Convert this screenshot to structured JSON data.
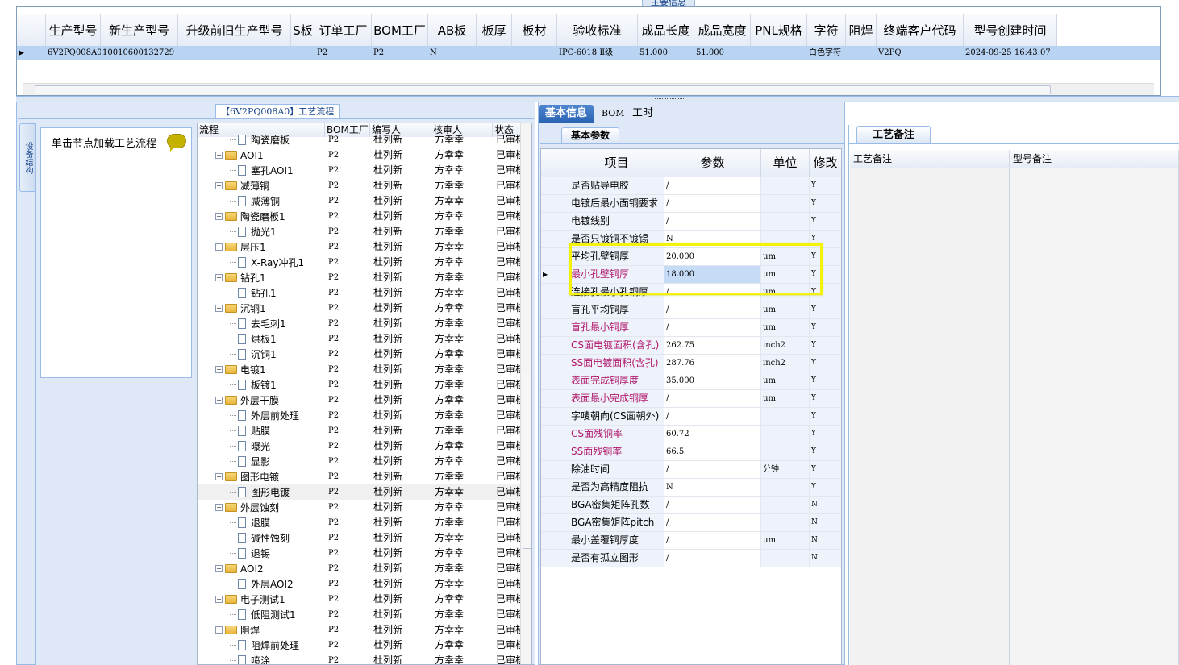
{
  "section_title": "主要信息",
  "main_grid": {
    "columns": [
      "生产型号",
      "新生产型号",
      "升级前旧生产型号",
      "S板",
      "订单工厂",
      "BOM工厂",
      "AB板",
      "板厚",
      "板材",
      "验收标准",
      "成品长度",
      "成品宽度",
      "PNL规格",
      "字符",
      "阻焊",
      "终端客户代码",
      "型号创建时间"
    ],
    "row": [
      "6V2PQ008A0",
      "10010600132729",
      "",
      "",
      "P2",
      "P2",
      "N",
      "",
      "",
      "IPC-6018 Ⅱ级",
      "51.000",
      "51.000",
      "",
      "白色字符",
      "",
      "V2PQ",
      "2024-09-25 16:43:07"
    ]
  },
  "flow_panel": {
    "title": "【6V2PQ008A0】工艺流程",
    "vertical_tab": "设备结构",
    "hint": "单击节点加载工艺流程"
  },
  "tree": {
    "columns": [
      "流程",
      "BOM工厂",
      "编写人",
      "核审人",
      "状态"
    ],
    "rows": [
      {
        "level": 1,
        "type": "doc",
        "name": "陶瓷磨板",
        "bom": "P2",
        "writer": "杜列新",
        "reviewer": "方幸幸",
        "status": "已审核"
      },
      {
        "level": 0,
        "type": "folder",
        "name": "AOI1",
        "bom": "P2",
        "writer": "杜列新",
        "reviewer": "方幸幸",
        "status": "已审核"
      },
      {
        "level": 1,
        "type": "doc",
        "name": "塞孔AOI1",
        "bom": "P2",
        "writer": "杜列新",
        "reviewer": "方幸幸",
        "status": "已审核"
      },
      {
        "level": 0,
        "type": "folder",
        "name": "减薄铜",
        "bom": "P2",
        "writer": "杜列新",
        "reviewer": "方幸幸",
        "status": "已审核"
      },
      {
        "level": 1,
        "type": "doc",
        "name": "减薄铜",
        "bom": "P2",
        "writer": "杜列新",
        "reviewer": "方幸幸",
        "status": "已审核"
      },
      {
        "level": 0,
        "type": "folder",
        "name": "陶瓷磨板1",
        "bom": "P2",
        "writer": "杜列新",
        "reviewer": "方幸幸",
        "status": "已审核"
      },
      {
        "level": 1,
        "type": "doc",
        "name": "抛光1",
        "bom": "P2",
        "writer": "杜列新",
        "reviewer": "方幸幸",
        "status": "已审核"
      },
      {
        "level": 0,
        "type": "folder",
        "name": "层压1",
        "bom": "P2",
        "writer": "杜列新",
        "reviewer": "方幸幸",
        "status": "已审核"
      },
      {
        "level": 1,
        "type": "doc",
        "name": "X-Ray冲孔1",
        "bom": "P2",
        "writer": "杜列新",
        "reviewer": "方幸幸",
        "status": "已审核"
      },
      {
        "level": 0,
        "type": "folder",
        "name": "钻孔1",
        "bom": "P2",
        "writer": "杜列新",
        "reviewer": "方幸幸",
        "status": "已审核"
      },
      {
        "level": 1,
        "type": "doc",
        "name": "钻孔1",
        "bom": "P2",
        "writer": "杜列新",
        "reviewer": "方幸幸",
        "status": "已审核"
      },
      {
        "level": 0,
        "type": "folder",
        "name": "沉铜1",
        "bom": "P2",
        "writer": "杜列新",
        "reviewer": "方幸幸",
        "status": "已审核"
      },
      {
        "level": 1,
        "type": "doc",
        "name": "去毛刺1",
        "bom": "P2",
        "writer": "杜列新",
        "reviewer": "方幸幸",
        "status": "已审核"
      },
      {
        "level": 1,
        "type": "doc",
        "name": "烘板1",
        "bom": "P2",
        "writer": "杜列新",
        "reviewer": "方幸幸",
        "status": "已审核"
      },
      {
        "level": 1,
        "type": "doc",
        "name": "沉铜1",
        "bom": "P2",
        "writer": "杜列新",
        "reviewer": "方幸幸",
        "status": "已审核"
      },
      {
        "level": 0,
        "type": "folder",
        "name": "电镀1",
        "bom": "P2",
        "writer": "杜列新",
        "reviewer": "方幸幸",
        "status": "已审核"
      },
      {
        "level": 1,
        "type": "doc",
        "name": "板镀1",
        "bom": "P2",
        "writer": "杜列新",
        "reviewer": "方幸幸",
        "status": "已审核"
      },
      {
        "level": 0,
        "type": "folder",
        "name": "外层干膜",
        "bom": "P2",
        "writer": "杜列新",
        "reviewer": "方幸幸",
        "status": "已审核"
      },
      {
        "level": 1,
        "type": "doc",
        "name": "外层前处理",
        "bom": "P2",
        "writer": "杜列新",
        "reviewer": "方幸幸",
        "status": "已审核"
      },
      {
        "level": 1,
        "type": "doc",
        "name": "贴膜",
        "bom": "P2",
        "writer": "杜列新",
        "reviewer": "方幸幸",
        "status": "已审核"
      },
      {
        "level": 1,
        "type": "doc",
        "name": "曝光",
        "bom": "P2",
        "writer": "杜列新",
        "reviewer": "方幸幸",
        "status": "已审核"
      },
      {
        "level": 1,
        "type": "doc",
        "name": "显影",
        "bom": "P2",
        "writer": "杜列新",
        "reviewer": "方幸幸",
        "status": "已审核"
      },
      {
        "level": 0,
        "type": "folder",
        "name": "图形电镀",
        "bom": "P2",
        "writer": "杜列新",
        "reviewer": "方幸幸",
        "status": "已审核"
      },
      {
        "level": 1,
        "type": "doc",
        "name": "图形电镀",
        "bom": "P2",
        "writer": "杜列新",
        "reviewer": "方幸幸",
        "status": "已审核",
        "selected": true
      },
      {
        "level": 0,
        "type": "folder",
        "name": "外层蚀刻",
        "bom": "P2",
        "writer": "杜列新",
        "reviewer": "方幸幸",
        "status": "已审核"
      },
      {
        "level": 1,
        "type": "doc",
        "name": "退膜",
        "bom": "P2",
        "writer": "杜列新",
        "reviewer": "方幸幸",
        "status": "已审核"
      },
      {
        "level": 1,
        "type": "doc",
        "name": "碱性蚀刻",
        "bom": "P2",
        "writer": "杜列新",
        "reviewer": "方幸幸",
        "status": "已审核"
      },
      {
        "level": 1,
        "type": "doc",
        "name": "退锡",
        "bom": "P2",
        "writer": "杜列新",
        "reviewer": "方幸幸",
        "status": "已审核"
      },
      {
        "level": 0,
        "type": "folder",
        "name": "AOI2",
        "bom": "P2",
        "writer": "杜列新",
        "reviewer": "方幸幸",
        "status": "已审核"
      },
      {
        "level": 1,
        "type": "doc",
        "name": "外层AOI2",
        "bom": "P2",
        "writer": "杜列新",
        "reviewer": "方幸幸",
        "status": "已审核"
      },
      {
        "level": 0,
        "type": "folder",
        "name": "电子测试1",
        "bom": "P2",
        "writer": "杜列新",
        "reviewer": "方幸幸",
        "status": "已审核"
      },
      {
        "level": 1,
        "type": "doc",
        "name": "低阻测试1",
        "bom": "P2",
        "writer": "杜列新",
        "reviewer": "方幸幸",
        "status": "已审核"
      },
      {
        "level": 0,
        "type": "folder",
        "name": "阻焊",
        "bom": "P2",
        "writer": "杜列新",
        "reviewer": "方幸幸",
        "status": "已审核"
      },
      {
        "level": 1,
        "type": "doc",
        "name": "阻焊前处理",
        "bom": "P2",
        "writer": "杜列新",
        "reviewer": "方幸幸",
        "status": "已审核"
      },
      {
        "level": 1,
        "type": "doc",
        "name": "喷涂",
        "bom": "P2",
        "writer": "杜列新",
        "reviewer": "方幸幸",
        "status": "已审核"
      }
    ]
  },
  "mid_tabs": [
    "基本信息",
    "BOM",
    "工时"
  ],
  "sub_tab": "基本参数",
  "params": {
    "columns": [
      "项目",
      "参数",
      "单位",
      "修改"
    ],
    "rows": [
      {
        "item": "是否贴导电胶",
        "value": "/",
        "unit": "",
        "mod": "Y",
        "red": false
      },
      {
        "item": "电镀后最小面铜要求",
        "value": "/",
        "unit": "",
        "mod": "Y",
        "red": false
      },
      {
        "item": "电镀线别",
        "value": "/",
        "unit": "",
        "mod": "Y",
        "red": false
      },
      {
        "item": "是否只镀铜不镀锡",
        "value": "N",
        "unit": "",
        "mod": "Y",
        "red": false
      },
      {
        "item": "平均孔壁铜厚",
        "value": "20.000",
        "unit": "μm",
        "mod": "Y",
        "red": false
      },
      {
        "item": "最小孔壁铜厚",
        "value": "18.000",
        "unit": "μm",
        "mod": "Y",
        "red": true,
        "selected": true
      },
      {
        "item": "连接孔最小孔铜厚",
        "value": "/",
        "unit": "μm",
        "mod": "Y",
        "red": false
      },
      {
        "item": "盲孔平均铜厚",
        "value": "/",
        "unit": "μm",
        "mod": "Y",
        "red": false
      },
      {
        "item": "盲孔最小铜厚",
        "value": "/",
        "unit": "μm",
        "mod": "Y",
        "red": true
      },
      {
        "item": "CS面电镀面积(含孔)",
        "value": "262.75",
        "unit": "inch2",
        "mod": "Y",
        "red": true
      },
      {
        "item": "SS面电镀面积(含孔)",
        "value": "287.76",
        "unit": "inch2",
        "mod": "Y",
        "red": true
      },
      {
        "item": "表面完成铜厚度",
        "value": "35.000",
        "unit": "μm",
        "mod": "Y",
        "red": true
      },
      {
        "item": "表面最小完成铜厚",
        "value": "/",
        "unit": "μm",
        "mod": "Y",
        "red": true
      },
      {
        "item": "字唛朝向(CS面朝外)",
        "value": "/",
        "unit": "",
        "mod": "Y",
        "red": false
      },
      {
        "item": "CS面残铜率",
        "value": "60.72",
        "unit": "",
        "mod": "Y",
        "red": true
      },
      {
        "item": "SS面残铜率",
        "value": "66.5",
        "unit": "",
        "mod": "Y",
        "red": true
      },
      {
        "item": "除油时间",
        "value": "/",
        "unit": "分钟",
        "mod": "Y",
        "red": false
      },
      {
        "item": "是否为高精度阻抗",
        "value": "N",
        "unit": "",
        "mod": "Y",
        "red": false
      },
      {
        "item": "BGA密集矩阵孔数",
        "value": "/",
        "unit": "",
        "mod": "N",
        "red": false
      },
      {
        "item": "BGA密集矩阵pitch",
        "value": "/",
        "unit": "",
        "mod": "N",
        "red": false
      },
      {
        "item": "最小盖覆铜厚度",
        "value": "/",
        "unit": "μm",
        "mod": "N",
        "red": false
      },
      {
        "item": "是否有孤立图形",
        "value": "/",
        "unit": "",
        "mod": "N",
        "red": false
      }
    ]
  },
  "right_panel": {
    "tab": "工艺备注",
    "col1": "工艺备注",
    "col2": "型号备注"
  },
  "colors": {
    "accent": "#2b64b4",
    "selection": "#b9d3f3",
    "highlight": "#f2f20c",
    "red_text": "#b0176b"
  }
}
